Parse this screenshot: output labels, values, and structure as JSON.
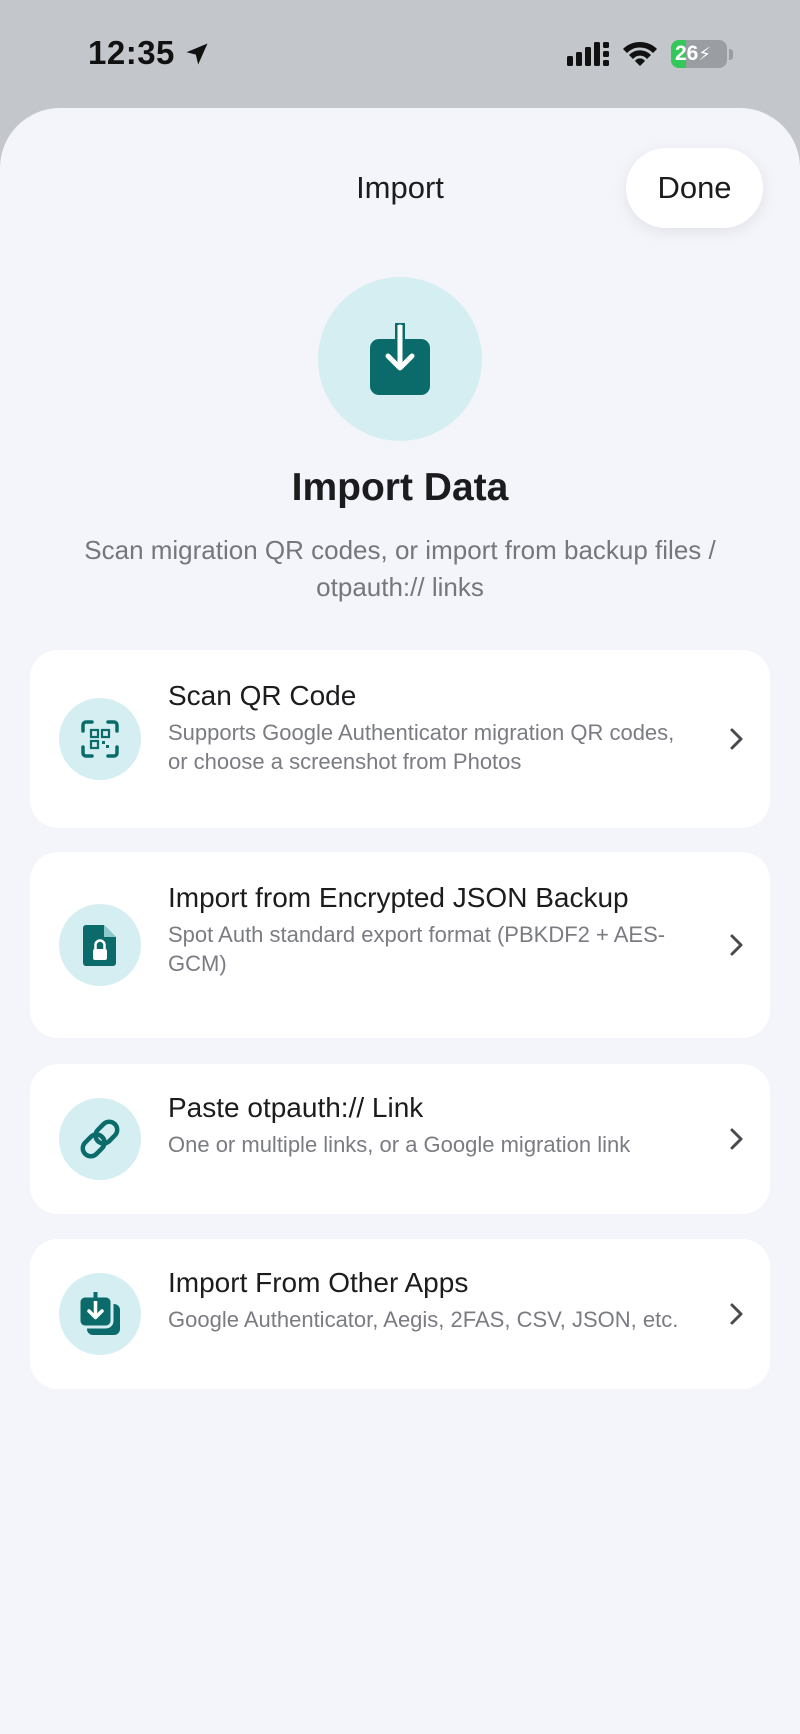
{
  "status_bar": {
    "time": "12:35",
    "battery_level": "26",
    "battery_fraction": 0.26,
    "icons": [
      "location-arrow-icon",
      "cellular-signal-icon",
      "wifi-icon",
      "battery-charging-icon"
    ]
  },
  "nav": {
    "title": "Import",
    "done_label": "Done"
  },
  "hero": {
    "icon": "download-box-icon",
    "title": "Import Data",
    "subtitle": "Scan migration QR codes, or import from backup files / otpauth:// links"
  },
  "options": [
    {
      "icon": "qr-scan-icon",
      "title": "Scan QR Code",
      "description": "Supports Google Authenticator migration QR codes, or choose a screenshot from Photos"
    },
    {
      "icon": "locked-file-icon",
      "title": "Import from Encrypted JSON Backup",
      "description": "Spot Auth standard export format (PBKDF2 + AES-GCM)"
    },
    {
      "icon": "link-icon",
      "title": "Paste otpauth:// Link",
      "description": "One or multiple links, or a Google migration link"
    },
    {
      "icon": "import-stack-icon",
      "title": "Import From Other Apps",
      "description": "Google Authenticator, Aegis, 2FAS, CSV, JSON, etc."
    }
  ],
  "colors": {
    "accent": "#0b6b6b",
    "icon_bg": "#d5eef1",
    "sheet_bg": "#f4f5fb",
    "card_bg": "#ffffff",
    "battery_green": "#34c759"
  }
}
